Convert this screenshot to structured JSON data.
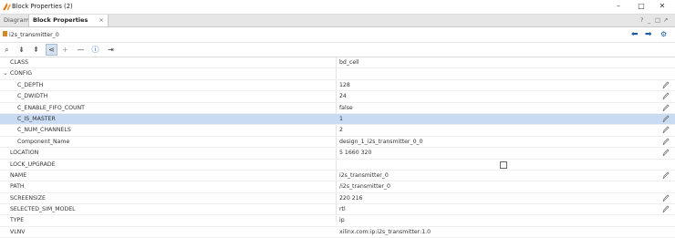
{
  "window": {
    "title": "Block Properties (2)"
  },
  "tabs": [
    {
      "label": "Diagram",
      "active": false
    },
    {
      "label": "Block Properties",
      "active": true,
      "close": "×"
    }
  ],
  "panel_controls": [
    "?",
    "_",
    "□",
    "↗"
  ],
  "object": {
    "name": "i2s_transmitter_0"
  },
  "toolbar": {
    "icons": [
      "search-icon",
      "collapse-all-icon",
      "expand-all-icon",
      "show-hierarchy-icon",
      "add-icon",
      "remove-icon",
      "info-icon",
      "export-icon"
    ]
  },
  "properties": [
    {
      "name": "CLASS",
      "value": "bd_cell",
      "editable": false
    },
    {
      "name": "CONFIG",
      "value": "",
      "group": true,
      "expanded": true
    },
    {
      "name": "C_DEPTH",
      "value": "128",
      "editable": true
    },
    {
      "name": "C_DWIDTH",
      "value": "24",
      "editable": true
    },
    {
      "name": "C_ENABLE_FIFO_COUNT",
      "value": "false",
      "editable": true
    },
    {
      "name": "C_IS_MASTER",
      "value": "1",
      "editable": true,
      "selected": true
    },
    {
      "name": "C_NUM_CHANNELS",
      "value": "2",
      "editable": true
    },
    {
      "name": "Component_Name",
      "value": "design_1_i2s_transmitter_0_0",
      "editable": true
    },
    {
      "name": "LOCATION",
      "value": "5 1660 320",
      "editable": true
    },
    {
      "name": "LOCK_UPGRADE",
      "value": "",
      "checkbox": true,
      "checked": false
    },
    {
      "name": "NAME",
      "value": "i2s_transmitter_0",
      "editable": true
    },
    {
      "name": "PATH",
      "value": "/i2s_transmitter_0",
      "editable": false
    },
    {
      "name": "SCREENSIZE",
      "value": "220 216",
      "editable": true
    },
    {
      "name": "SELECTED_SIM_MODEL",
      "value": "rtl",
      "editable": true
    },
    {
      "name": "TYPE",
      "value": "ip",
      "editable": false
    },
    {
      "name": "VLNV",
      "value": "xilinx.com:ip:i2s_transmitter:1.0",
      "editable": false
    }
  ],
  "colors": {
    "selection": "#c9daf3",
    "accent": "#1a5aa8"
  }
}
